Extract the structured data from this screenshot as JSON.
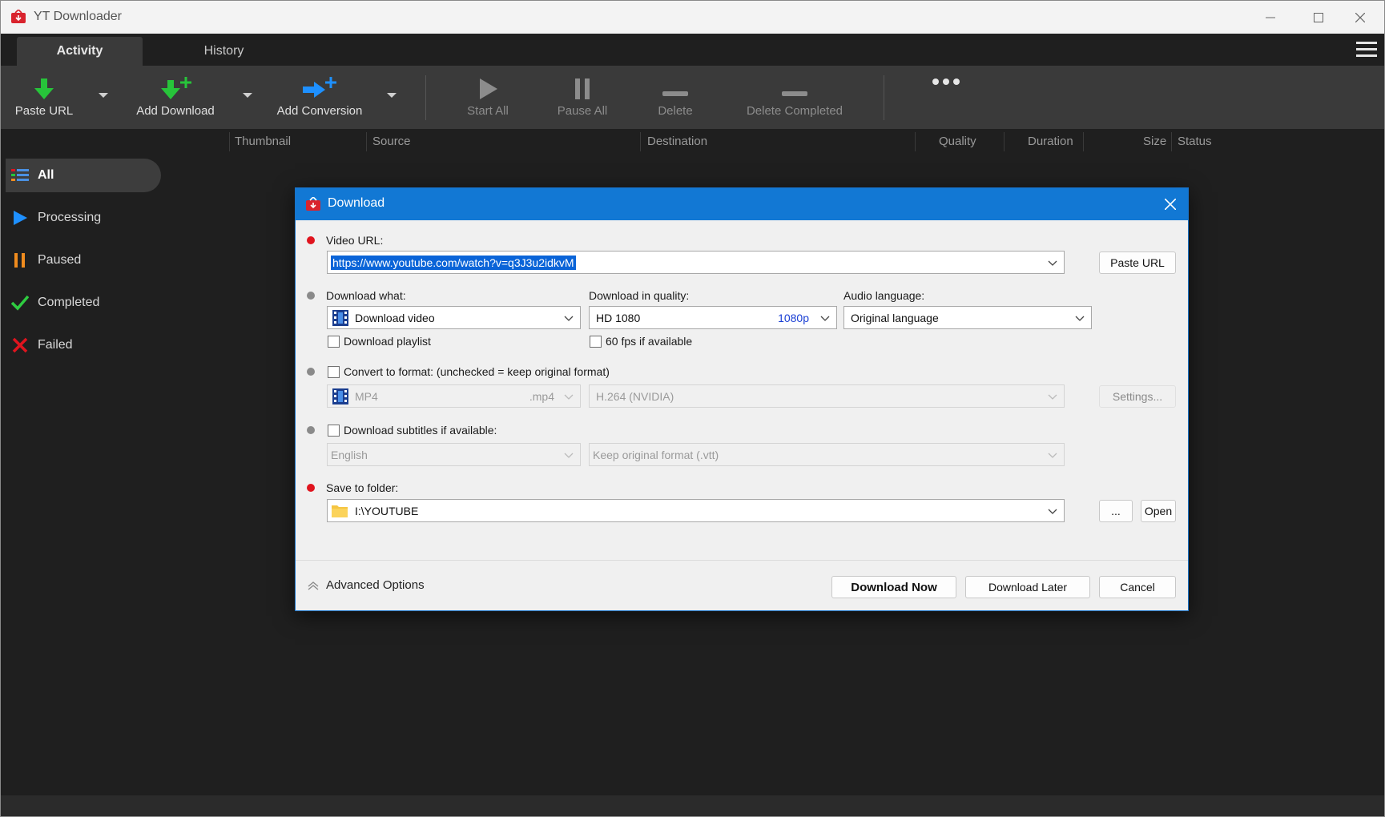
{
  "app": {
    "title": "YT Downloader"
  },
  "tabs": [
    {
      "label": "Activity",
      "active": true
    },
    {
      "label": "History",
      "active": false
    }
  ],
  "toolbar": {
    "paste_url": "Paste URL",
    "add_download": "Add Download",
    "add_conversion": "Add Conversion",
    "start_all": "Start All",
    "pause_all": "Pause All",
    "delete": "Delete",
    "delete_completed": "Delete Completed",
    "more": "•••"
  },
  "columns": [
    "Thumbnail",
    "Source",
    "Destination",
    "Quality",
    "Duration",
    "Size",
    "Status"
  ],
  "sidebar": [
    {
      "label": "All",
      "icon": "list-icon",
      "color": "#4a90e2"
    },
    {
      "label": "Processing",
      "icon": "play-icon",
      "color": "#1e90ff"
    },
    {
      "label": "Paused",
      "icon": "pause-icon",
      "color": "#f08c1e"
    },
    {
      "label": "Completed",
      "icon": "check-icon",
      "color": "#2ecc40"
    },
    {
      "label": "Failed",
      "icon": "cross-icon",
      "color": "#e0141e"
    }
  ],
  "dialog": {
    "title": "Download",
    "video_url_label": "Video URL:",
    "video_url_value": "https://www.youtube.com/watch?v=q3J3u2idkvM",
    "paste_url": "Paste URL",
    "download_what_label": "Download what:",
    "download_what_value": "Download video",
    "download_playlist": "Download playlist",
    "quality_label": "Download in quality:",
    "quality_value": "HD 1080",
    "quality_badge": "1080p",
    "fps_label": "60 fps if available",
    "audio_language_label": "Audio language:",
    "audio_language_value": "Original language",
    "convert_label": "Convert to format: (unchecked = keep original format)",
    "format_value": "MP4",
    "format_ext": ".mp4",
    "codec_value": "H.264 (NVIDIA)",
    "settings": "Settings...",
    "subtitles_label": "Download subtitles if available:",
    "subtitle_language": "English",
    "subtitle_format": "Keep original format (.vtt)",
    "save_folder_label": "Save to folder:",
    "save_folder_value": "I:\\YOUTUBE",
    "browse": "...",
    "open": "Open",
    "advanced_options": "Advanced Options",
    "download_now": "Download Now",
    "download_later": "Download Later",
    "cancel": "Cancel"
  },
  "colors": {
    "accent": "#1278d4",
    "required": "#e0141e",
    "toolbar_green": "#27c43a",
    "toolbar_blue": "#1e90ff"
  }
}
